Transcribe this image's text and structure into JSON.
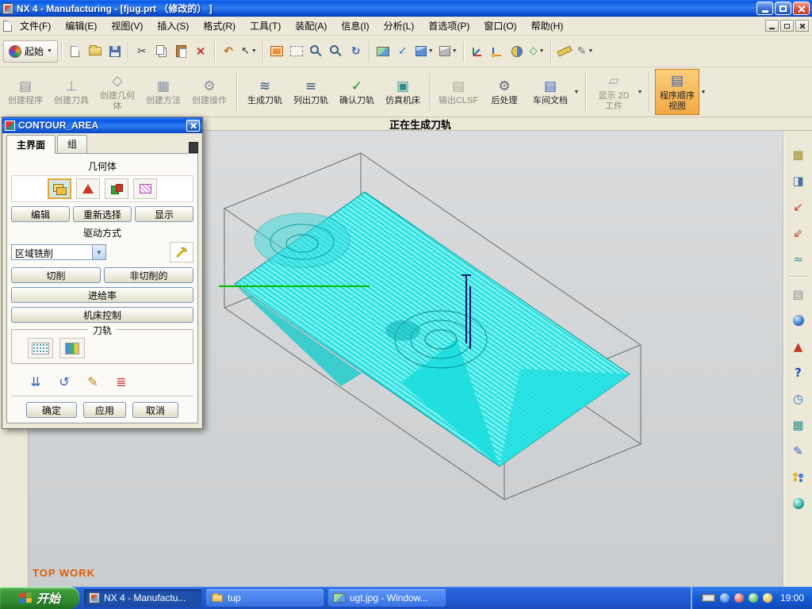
{
  "icons": {
    "dropdown": "▼",
    "scissors": "✂",
    "undo": "↶",
    "rotate": "↻",
    "check": "✓",
    "pencil": "✎",
    "help": "?",
    "wave": "≈",
    "arrow_sw": "↙",
    "arrow_sw_dbl": "⇙",
    "clock_face": "◷",
    "grid": "▦",
    "rows": "▤",
    "half_square": "◨",
    "triangle": "▲",
    "gear": "⚙",
    "lines": "≡",
    "zigzag": "≋",
    "tool_post": "⊥",
    "diamond": "◇",
    "cursor": "↖",
    "down_arrows": "⇊",
    "replay": "↺",
    "list_bars": "≣",
    "parallelogram": "▱",
    "square_dot": "▣"
  },
  "window": {
    "title": "NX 4 - Manufacturing - [fjug.prt （修改的） ]"
  },
  "menubar": {
    "items": [
      "文件(F)",
      "编辑(E)",
      "视图(V)",
      "插入(S)",
      "格式(R)",
      "工具(T)",
      "装配(A)",
      "信息(I)",
      "分析(L)",
      "首选项(P)",
      "窗口(O)",
      "帮助(H)"
    ]
  },
  "toolbar_main": {
    "start_label": "起始"
  },
  "toolbar_cam": {
    "items": [
      {
        "label": "创建程序"
      },
      {
        "label": "创建刀具"
      },
      {
        "label": "创建几何体"
      },
      {
        "label": "创建方法"
      },
      {
        "label": "创建操作"
      },
      {
        "label": "生成刀轨"
      },
      {
        "label": "列出刀轨"
      },
      {
        "label": "确认刀轨"
      },
      {
        "label": "仿真机床"
      },
      {
        "label": "输出CLSF"
      },
      {
        "label": "后处理"
      },
      {
        "label": "车间文档"
      },
      {
        "label": "显示 2D 工件"
      },
      {
        "label": "程序顺序视图"
      }
    ]
  },
  "statusbar": {
    "message": "正在生成刀轨"
  },
  "viewport": {
    "annotation": "TOP WORK"
  },
  "dialog": {
    "title": "CONTOUR_AREA",
    "tabs": [
      "主界面",
      "组"
    ],
    "geometry": {
      "label": "几何体",
      "edit": "编辑",
      "reselect": "重新选择",
      "display": "显示"
    },
    "drive": {
      "label": "驱动方式",
      "method": "区域铣削"
    },
    "cutting": "切削",
    "non_cutting": "非切削的",
    "feedrate": "进给率",
    "machine_control": "机床控制",
    "toolpath": {
      "label": "刀轨"
    },
    "ok": "确定",
    "apply": "应用",
    "cancel": "取消"
  },
  "taskbar": {
    "start_label": "开始",
    "tasks": [
      "NX 4 - Manufactu...",
      "tup",
      "ugt.jpg - Window..."
    ],
    "clock": "19:00"
  }
}
